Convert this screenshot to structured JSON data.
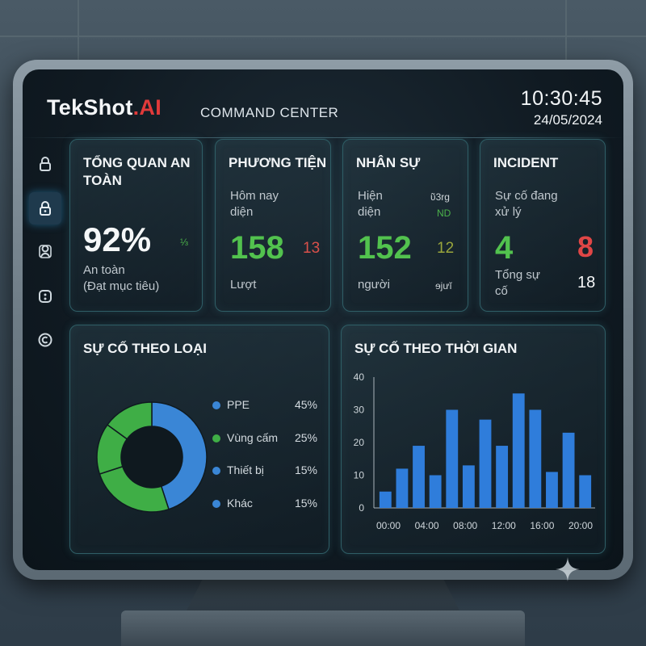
{
  "header": {
    "logo_main": "TekShot",
    "logo_dot": ".",
    "logo_ai": "AI",
    "title": "COMMAND CENTER",
    "time": "10:30:45",
    "date": "24/05/2024"
  },
  "sidebar": {
    "items": [
      {
        "icon": "lock-icon"
      },
      {
        "icon": "lock-icon",
        "active": true
      },
      {
        "icon": "user-icon"
      },
      {
        "icon": "face-icon"
      },
      {
        "icon": "copyright-icon"
      }
    ]
  },
  "safety": {
    "title_line1": "TỔNG QUAN AN",
    "title_line2": "TOÀN",
    "value": "92%",
    "side_note": "⅓",
    "label_line1": "An toàn",
    "label_line2": "(Đạt mục tiêu)"
  },
  "vehicles": {
    "title": "PHƯƠNG TIỆN",
    "label_line1": "Hôm nay",
    "label_line2": "diện",
    "value": "158",
    "secondary": "13",
    "unit": "Lượt"
  },
  "personnel": {
    "title": "NHÂN SỰ",
    "label_line1": "Hiện",
    "label_line2": "diện",
    "tag_top": "ῦ3rg",
    "tag_bottom": "ND",
    "value": "152",
    "secondary": "12",
    "unit": "người",
    "unit_right": "ɘjưĭ"
  },
  "incident": {
    "title": "INCIDENT",
    "label_line1": "Sự cố đang",
    "label_line2": "xử lý",
    "value": "4",
    "secondary": "8",
    "total_label_line1": "Tổng sự",
    "total_label_line2": "cố",
    "total_value": "18"
  },
  "by_type": {
    "title": "SỰ CỐ THEO LOẠI",
    "legend": [
      {
        "label": "PPE",
        "pct": "45%",
        "color": "#3a86d6"
      },
      {
        "label": "Vùng cấm",
        "pct": "25%",
        "color": "#3fae46"
      },
      {
        "label": "Thiết bị",
        "pct": "15%",
        "color": "#3a86d6"
      },
      {
        "label": "Khác",
        "pct": "15%",
        "color": "#3a86d6"
      }
    ]
  },
  "by_time": {
    "title": "SỰ CỐ THEO THỜI GIAN"
  },
  "chart_data": [
    {
      "type": "pie",
      "style": "donut",
      "categories": [
        "PPE",
        "Vùng cấm",
        "Thiết bị",
        "Khác"
      ],
      "values": [
        45,
        25,
        15,
        15
      ],
      "colors": [
        "#3a86d6",
        "#3fae46",
        "#3fae46",
        "#3fae46"
      ]
    },
    {
      "type": "bar",
      "x_ticks": [
        "00:00",
        "04:00",
        "08:00",
        "12:00",
        "16:00",
        "20:00"
      ],
      "y_ticks": [
        "40",
        "30",
        "20",
        "10",
        "0"
      ],
      "ylim": [
        0,
        40
      ],
      "values": [
        5,
        12,
        19,
        10,
        30,
        13,
        27,
        19,
        35,
        30,
        11,
        23,
        10
      ],
      "bar_color": "#2f7ddb"
    }
  ]
}
